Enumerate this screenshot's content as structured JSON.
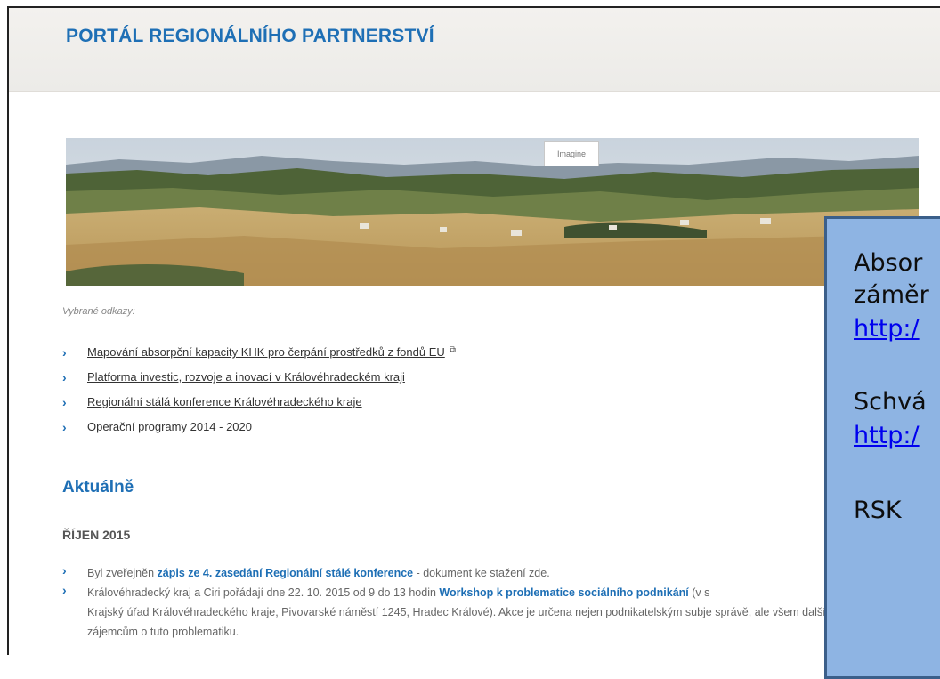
{
  "header": {
    "title": "PORTÁL REGIONÁLNÍHO PARTNERSTVÍ"
  },
  "banner": {
    "label": "Imagine"
  },
  "links": {
    "heading": "Vybrané odkazy:",
    "items": [
      {
        "label": "Mapování absorpční kapacity KHK pro čerpání prostředků z fondů EU",
        "external": true
      },
      {
        "label": "Platforma investic, rozvoje a inovací v Královéhradeckém kraji"
      },
      {
        "label": "Regionální stálá konference Královéhradeckého kraje"
      },
      {
        "label": "Operační programy 2014 - 2020"
      }
    ]
  },
  "news": {
    "title": "Aktuálně",
    "month": "ŘÍJEN 2015",
    "items": [
      {
        "prefix": "Byl zveřejněn ",
        "bold": "zápis ze 4. zasedání Regionální stálé konference",
        "middle": " - ",
        "link": "dokument ke stažení zde",
        "suffix": "."
      },
      {
        "prefix": "Královéhradecký kraj a Ciri pořádají dne 22. 10. 2015 od 9 do 13 hodin ",
        "bold": "Workshop k problematice sociálního podnikání",
        "middle": " (v s",
        "link": "",
        "suffix": "Krajský úřad Královéhradeckého kraje, Pivovarské náměstí 1245, Hradec Králové). Akce je určena nejen podnikatelským subje správě, ale všem dalším zájemcům o tuto problematiku."
      }
    ]
  },
  "overlay": {
    "lines": [
      "Absor",
      "záměr",
      "http:/",
      "Schvá",
      "http:/",
      "RSK"
    ]
  }
}
